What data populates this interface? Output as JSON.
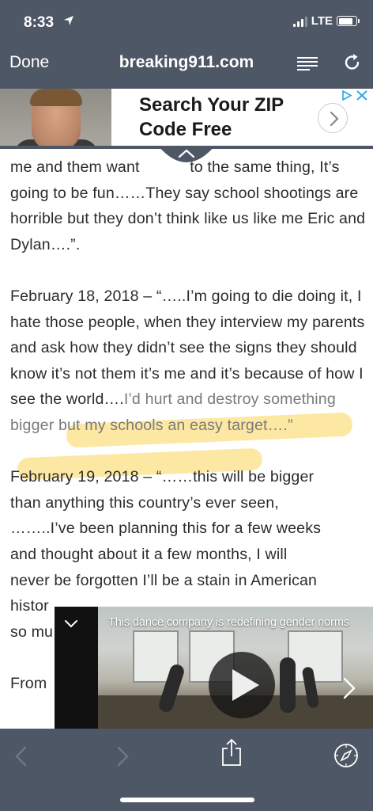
{
  "status_bar": {
    "time": "8:33",
    "network": "LTE",
    "location_icon": "location-arrow-icon",
    "battery_level": 0.85
  },
  "nav": {
    "done_label": "Done",
    "site": "breaking911.com",
    "reader_icon": "reader-menu-icon",
    "refresh_icon": "refresh-icon"
  },
  "ad": {
    "headline_line1": "Search Your ZIP",
    "headline_line2": "Code Free",
    "choices_icon": "adchoices-icon",
    "arrow_icon": "chevron-right-icon"
  },
  "article": {
    "para1_line1a": "me and them want ",
    "para1_line1b": "to the same thing,",
    "para1_rest": "It’s going to be fun……They say school shootings are horrible but they don’t think like us like me Eric and Dylan….”.",
    "para2_plain": "February 18, 2018 – “…..I’m going to die doing it, I hate those people, when they interview my parents and ask how they didn’t see the signs they should know it’s not them it’s me and it’s because of how I see the world….",
    "para2_highlight": "I’d hurt and destroy something bigger but my schools an easy target….”",
    "para3_l1": "February 19, 2018 – “……this will be bigger",
    "para3_l2": "than anything this country’s ever seen,",
    "para3_l3": "……..I’ve been planning this for a few weeks",
    "para3_l4": "and thought about it a few months, I will",
    "para3_l5": "never be forgotten I’ll be a stain in American",
    "para3_l6": "histor",
    "para3_l7": "so mu",
    "para4_l1": "From "
  },
  "video": {
    "title": "This dance company is redefining gender norms",
    "collapse_icon": "chevron-down-icon",
    "play_icon": "play-icon",
    "next_icon": "chevron-right-icon"
  },
  "toolbar": {
    "back_icon": "back-arrow-icon",
    "forward_icon": "forward-arrow-icon",
    "share_icon": "share-icon",
    "safari_icon": "compass-icon"
  },
  "colors": {
    "chrome": "#4e5766",
    "highlight": "#fcd558",
    "text": "#2b2b2b"
  }
}
